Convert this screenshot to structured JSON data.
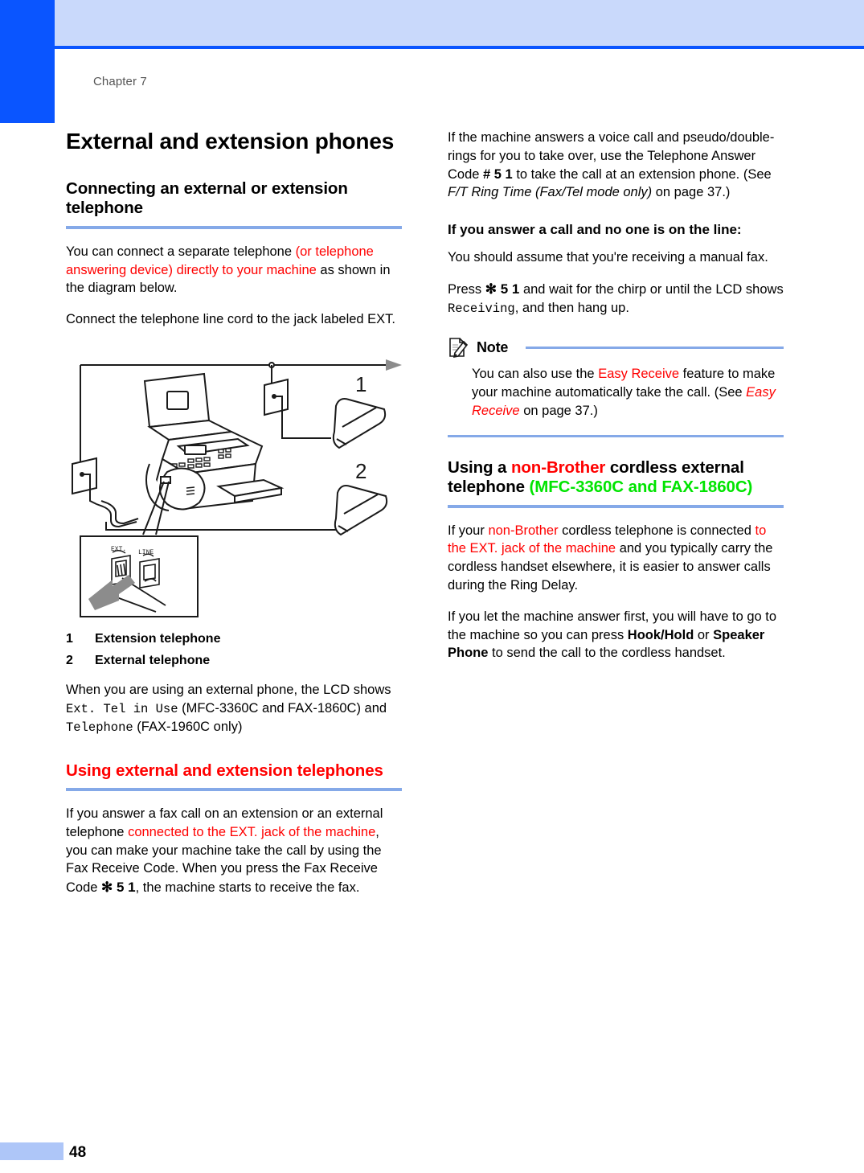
{
  "page": {
    "chapter_label": "Chapter 7",
    "page_number": "48",
    "accent_blue": "#0a55ff",
    "header_band": "#c9d9fb",
    "rule_blue": "#85a9e8",
    "footer_bar": "#aec6f8",
    "highlight_red": "#ff0000",
    "highlight_green": "#00e400"
  },
  "left_column": {
    "title": "External and extension phones",
    "section1": {
      "heading": "Connecting an external or extension telephone",
      "p1": {
        "seg1": "You can connect a separate telephone ",
        "seg2_red": "(or telephone answering device) directly to your machine",
        "seg3": " as shown in the diagram below."
      },
      "p2_red": "Connect the telephone line cord to the jack labeled EXT."
    },
    "figure": {
      "caption_items": [
        {
          "num": "1",
          "label": "Extension telephone"
        },
        {
          "num": "2",
          "label": "External telephone"
        }
      ],
      "callout_1": "1",
      "callout_2": "2",
      "inset_label_ext": "EXT.",
      "inset_label_line": "LINE"
    },
    "after_figure_green": {
      "seg1": "When you are using an external phone, the LCD shows ",
      "seg2_mono": "Ext. Tel in Use",
      "seg3": " (MFC-3360C and FAX-1860C) and ",
      "seg4_mono": "Telephone",
      "seg5": " (FAX-1960C only)"
    },
    "section2": {
      "heading_red": "Using external and extension telephones",
      "p1": {
        "seg1": "If you answer a fax call on an extension or an external telephone ",
        "seg2_red": "connected to the EXT. jack of the machine",
        "seg3": ", you can make your machine take the call by using the Fax Receive Code. When you press the Fax Receive Code ",
        "seg4_code": "✻ 5 1",
        "seg5": ", the machine starts to receive the fax."
      }
    }
  },
  "right_column": {
    "p1": {
      "seg1": "If the machine answers a voice call and pseudo/double-rings for you to take over, use the Telephone Answer Code ",
      "seg2_code": "# 5 1",
      "seg3": " to take the call at an extension phone. (See ",
      "seg4_italic": "F/T Ring Time (Fax/Tel mode only)",
      "seg5": " on page 37.)"
    },
    "subheading": "If you answer a call and no one is on the line:",
    "p2": "You should assume that you're receiving a manual fax.",
    "p3": {
      "seg1": "Press ",
      "seg2_code": "✻  5 1",
      "seg3": " and wait for the chirp or until the LCD shows ",
      "seg4_mono": "Receiving",
      "seg5": ", and then hang up."
    },
    "note": {
      "title": "Note",
      "icon": "note-pencil-icon",
      "body": {
        "seg1": "You can also use the ",
        "seg2_red": "Easy Receive",
        "seg3": " feature to make your machine automatically take the call. (See ",
        "seg4_red_italic": "Easy Receive",
        "seg5": " on page 37.)"
      }
    },
    "section": {
      "heading": {
        "seg1": "Using a ",
        "seg2_red": "non-Brother",
        "seg3": " cordless external telephone ",
        "seg4_green": "(MFC-3360C and FAX-1860C)"
      },
      "p1": {
        "seg1": "If your ",
        "seg2_red": "non-Brother",
        "seg3": " cordless telephone is connected ",
        "seg4_red": "to the EXT. jack of the machine",
        "seg5": " and you typically carry the cordless handset elsewhere, it is easier to answer calls during the Ring Delay."
      },
      "p2_green": {
        "seg1": "If you let the machine answer first, you will have to go to the machine so you can press ",
        "seg2_bold": "Hook/Hold",
        "seg3": " or ",
        "seg4_bold": "Speaker Phone",
        "seg5": " to send the call to the cordless handset."
      }
    }
  }
}
